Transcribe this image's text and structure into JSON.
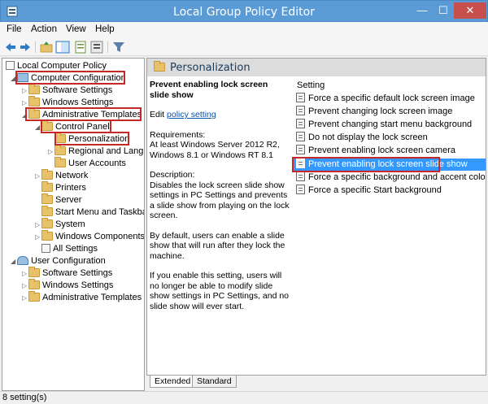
{
  "window": {
    "title": "Local Group Policy Editor",
    "min": "—",
    "max": "☐",
    "close": "✕"
  },
  "menu": [
    "File",
    "Action",
    "View",
    "Help"
  ],
  "tree": {
    "root": "Local Computer Policy",
    "nodes": [
      "Computer Configuration",
      "Software Settings",
      "Windows Settings",
      "Administrative Templates",
      "Control Panel",
      "Personalization",
      "Regional and Langu",
      "User Accounts",
      "Network",
      "Printers",
      "Server",
      "Start Menu and Taskba",
      "System",
      "Windows Components",
      "All Settings",
      "User Configuration",
      "Software Settings",
      "Windows Settings",
      "Administrative Templates"
    ]
  },
  "right": {
    "header": "Personalization",
    "policy_title": "Prevent enabling lock screen slide show",
    "edit_prefix": "Edit",
    "edit_link": "policy setting",
    "req_label": "Requirements:",
    "req_text": "At least Windows Server 2012 R2, Windows 8.1 or Windows RT 8.1",
    "desc_label": "Description:",
    "desc_text": "Disables the lock screen slide show settings in PC Settings and prevents a slide show from playing on the lock screen.",
    "default_text": "By default, users can enable a slide show that will run after they lock the machine.",
    "enable_text": "If you enable this setting, users will no longer be able to modify slide show settings in PC Settings, and no slide show will ever start.",
    "column": "Setting",
    "settings": [
      "Force a specific default lock screen image",
      "Prevent changing lock screen image",
      "Prevent changing start menu background",
      "Do not display the lock screen",
      "Prevent enabling lock screen camera",
      "Prevent enabling lock screen slide show",
      "Force a specific background and accent color",
      "Force a specific Start background"
    ]
  },
  "tabs": [
    "Extended",
    "Standard"
  ],
  "status": "8 setting(s)"
}
